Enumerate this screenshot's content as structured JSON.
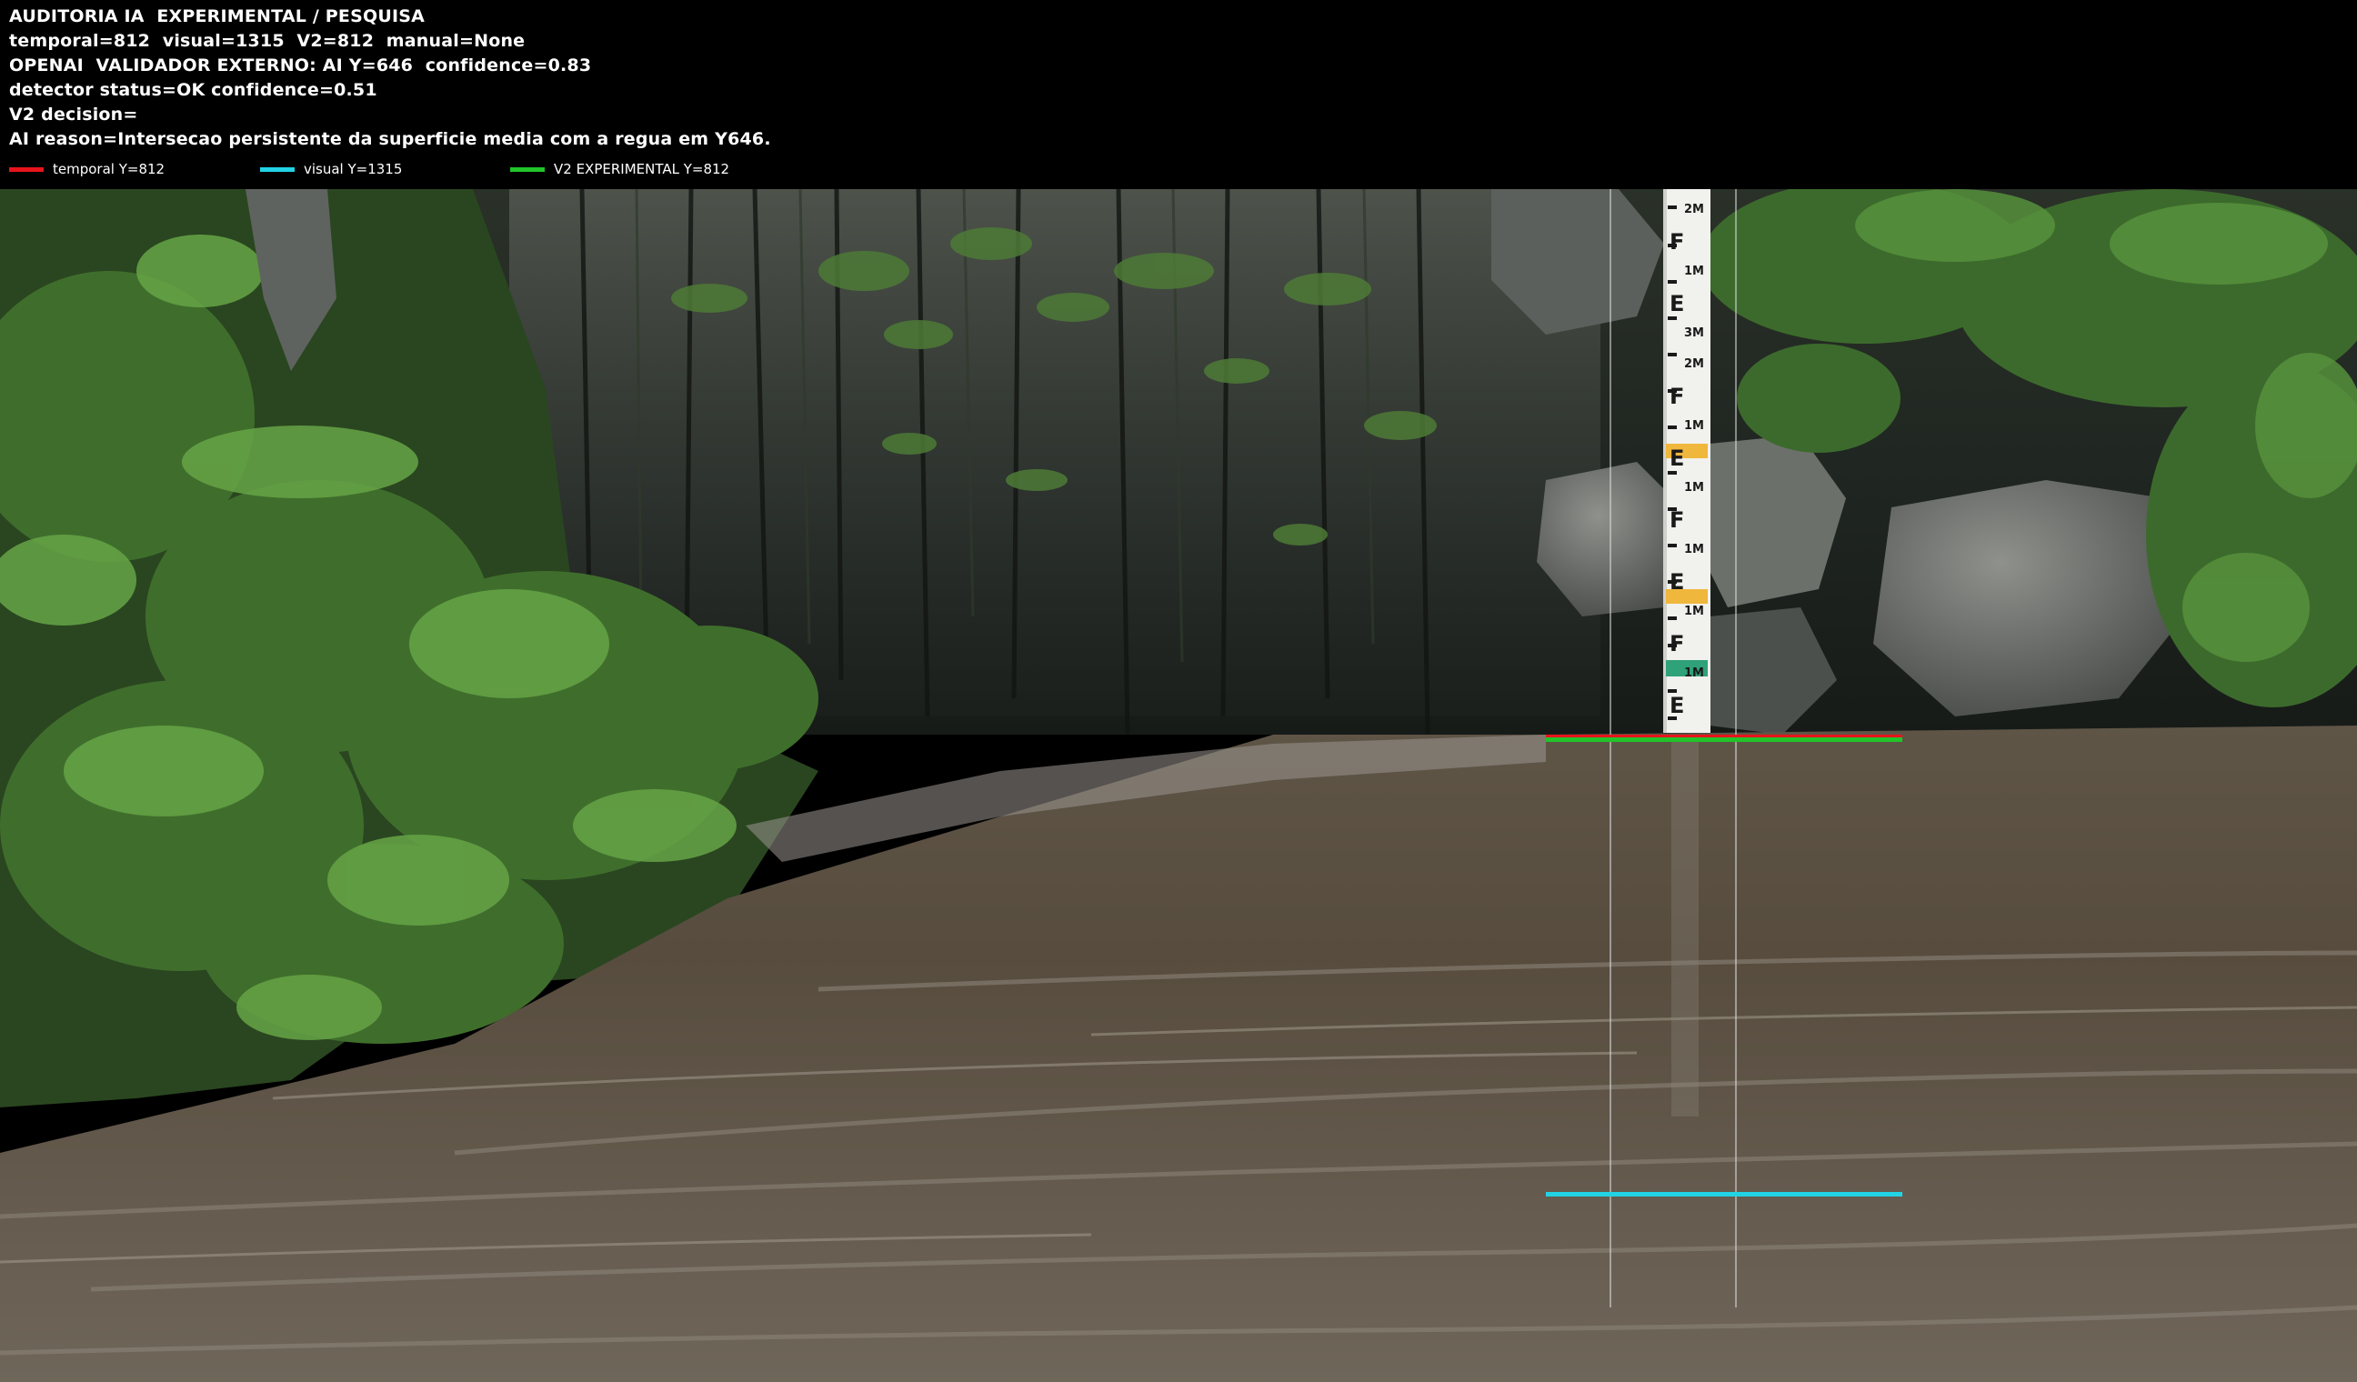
{
  "header": {
    "line1": "AUDITORIA IA  EXPERIMENTAL / PESQUISA",
    "line2": "temporal=812  visual=1315  V2=812  manual=None",
    "line3": "OPENAI  VALIDADOR EXTERNO: AI Y=646  confidence=0.83",
    "line4": "detector status=OK confidence=0.51",
    "line5": "V2 decision=",
    "line6": "AI reason=Intersecao persistente da superficie media com a regua em Y646."
  },
  "legend": {
    "temporal": {
      "label": "temporal Y=812",
      "color": "#e8141c"
    },
    "visual": {
      "label": "visual Y=1315",
      "color": "#22d3e6"
    },
    "v2": {
      "label": "V2 EXPERIMENTAL Y=812",
      "color": "#21c42a"
    }
  },
  "gauge": {
    "labels": [
      "2M",
      "F",
      "1M",
      "E",
      "3M",
      "2M",
      "F",
      "1M",
      "E",
      "1M",
      "F",
      "1M",
      "E",
      "1M",
      "F",
      "1M",
      "E"
    ]
  }
}
